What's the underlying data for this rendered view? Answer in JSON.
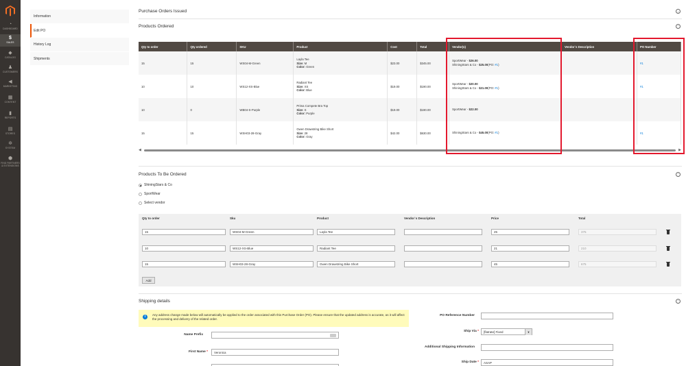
{
  "menu": {
    "items": [
      {
        "label": "DASHBOARD",
        "icon": "dashboard-icon"
      },
      {
        "label": "SALES",
        "icon": "dollar-icon"
      },
      {
        "label": "CATALOG",
        "icon": "box-icon"
      },
      {
        "label": "CUSTOMERS",
        "icon": "person-icon"
      },
      {
        "label": "MARKETING",
        "icon": "megaphone-icon"
      },
      {
        "label": "CONTENT",
        "icon": "content-icon"
      },
      {
        "label": "REPORTS",
        "icon": "bar-chart-icon"
      },
      {
        "label": "STORES",
        "icon": "store-icon"
      },
      {
        "label": "SYSTEM",
        "icon": "gear-icon"
      },
      {
        "label": "FIND PARTNERS & EXTENSIONS",
        "icon": "partners-icon"
      }
    ]
  },
  "tabs": [
    {
      "label": "Information"
    },
    {
      "label": "Edit PO"
    },
    {
      "label": "History Log"
    },
    {
      "label": "Shipments"
    }
  ],
  "sections": {
    "issued": "Purchase Orders Issued",
    "ordered": "Products Ordered",
    "to_order": "Products To Be Ordered",
    "shipping": "Shipping details"
  },
  "ordered_table": {
    "headers": [
      "Qty to order",
      "Qty ordered",
      "SKU",
      "Product",
      "Cost",
      "Total",
      "Vendor(s)",
      "Vendor`s Description",
      "PO Number"
    ],
    "rows": [
      {
        "qty_to_order": "15",
        "qty_ordered": "15",
        "sku": "WS04-M-Green",
        "product": "Layla Tee",
        "size": "M",
        "color": "Green",
        "cost": "$23.00",
        "total": "$345.00",
        "vendor1_name": "SportWear - ",
        "vendor1_price": "$26.00",
        "vendor2_name": "ShiningStars & Co - ",
        "vendor2_price": "$25.00",
        "vendor2_po_prefix": "(PO: ",
        "vendor2_po": "#1",
        "vendor2_po_suffix": ")",
        "po_number": "#1"
      },
      {
        "qty_to_order": "10",
        "qty_ordered": "10",
        "sku": "WS12-XS-Blue",
        "product": "Radiant Tee",
        "size": "XS",
        "color": "Blue",
        "cost": "$19.00",
        "total": "$190.00",
        "vendor1_name": "SportWear - ",
        "vendor1_price": "$20.00",
        "vendor2_name": "ShiningStars & Co - ",
        "vendor2_price": "$21.00",
        "vendor2_po_prefix": "(PO: ",
        "vendor2_po": "#1",
        "vendor2_po_suffix": ")",
        "po_number": "#1"
      },
      {
        "qty_to_order": "10",
        "qty_ordered": "0",
        "sku": "WB04-S-Purple",
        "product": "Prima Compete Bra Top",
        "size": "S",
        "color": "Purple",
        "cost": "$19.00",
        "total": "$190.00",
        "vendor1_name": "SportWear - ",
        "vendor1_price": "$22.00",
        "po_number": ""
      },
      {
        "qty_to_order": "15",
        "qty_ordered": "15",
        "sku": "WSH03-28-Gray",
        "product": "Gwen Drawstring Bike Short",
        "size": "28",
        "color": "Gray",
        "cost": "$42.00",
        "total": "$630.00",
        "vendor1_name": "ShiningStars & Co - ",
        "vendor1_price": "$45.00",
        "vendor1_po_prefix": "(PO: ",
        "vendor1_po": "#1",
        "vendor1_po_suffix": ")",
        "po_number": "#1"
      }
    ],
    "size_label": "Size: ",
    "color_label": "Color: "
  },
  "to_order": {
    "vendor_options": [
      {
        "label": "ShiningStars & Co",
        "selected": true
      },
      {
        "label": "SportWear",
        "selected": false
      },
      {
        "label": "Select vendor",
        "selected": false
      }
    ],
    "headers": [
      "Qty to order",
      "Sku",
      "Product",
      "Vendor`s Description",
      "Price",
      "Total"
    ],
    "rows": [
      {
        "qty": "15",
        "sku": "WS04-M-Green",
        "product": "Layla Tee",
        "desc": "",
        "price": "25",
        "total": "375"
      },
      {
        "qty": "10",
        "sku": "WS12-XS-Blue",
        "product": "Radiant Tee",
        "desc": "",
        "price": "21",
        "total": "210"
      },
      {
        "qty": "15",
        "sku": "WSH03-28-Gray",
        "product": "Gwen Drawstring Bike Short",
        "desc": "",
        "price": "45",
        "total": "675"
      }
    ],
    "add_label": "Add"
  },
  "shipping": {
    "notice": "Any address change made below will automatically be applied to the order associated with this Purchase Order (PO). Please ensure that the updated address is accurate, as it will affect the processing and delivery of the related order.",
    "name_prefix_label": "Name Prefix",
    "name_prefix_value": "",
    "first_name_label": "First Name",
    "first_name_value": "Veronica",
    "po_reference_label": "PO Reference Number",
    "po_reference_value": "",
    "ship_via_label": "Ship Via",
    "ship_via_value": "[flatrate] Fixed",
    "additional_label": "Additional Shipping Information",
    "additional_value": "",
    "ship_date_label": "Ship Date",
    "ship_date_value": "ASAP",
    "required_mark": "*"
  },
  "colors": {
    "menu_bg": "#373330",
    "table_header": "#514943",
    "link": "#007bdb",
    "highlight_box": "#e3182d",
    "accent": "#eb5202"
  }
}
